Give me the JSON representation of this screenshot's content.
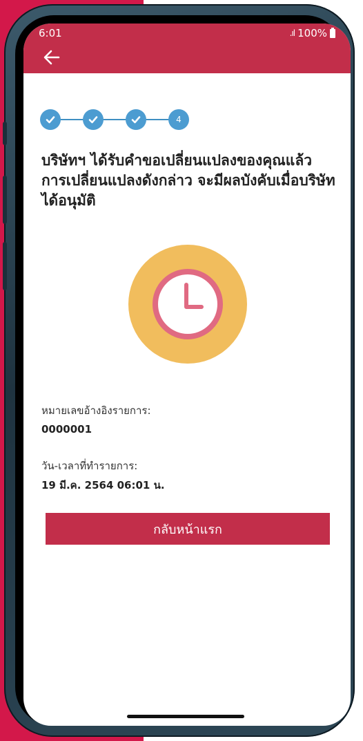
{
  "status_bar": {
    "time": "6:01",
    "signal": ".ıl",
    "battery_percent": "100%"
  },
  "app_bar": {
    "back_icon": "arrow-left-icon",
    "color": "#c22e4a"
  },
  "stepper": {
    "steps": [
      {
        "state": "done",
        "icon": "check-icon"
      },
      {
        "state": "done",
        "icon": "check-icon"
      },
      {
        "state": "done",
        "icon": "check-icon"
      },
      {
        "state": "current",
        "label": "4"
      }
    ],
    "color": "#4c9cd1"
  },
  "main": {
    "headline": "บริษัทฯ ได้รับคำขอเปลี่ยนแปลงของคุณแล้ว การเปลี่ยนแปลงดังกล่าว จะมีผลบังคับเมื่อบริษัทได้อนุมัติ",
    "status_icon": "clock-icon",
    "reference_label": "หมายเลขอ้างอิงรายการ:",
    "reference_value": "0000001",
    "datetime_label": "วัน-เวลาที่ทำรายการ:",
    "datetime_value": "19 มี.ค. 2564 06:01 น.",
    "home_button_label": "กลับหน้าแรก"
  },
  "colors": {
    "brand_red": "#c22e4a",
    "clock_outer": "#f1bd5d",
    "clock_ring": "#e06a82"
  }
}
